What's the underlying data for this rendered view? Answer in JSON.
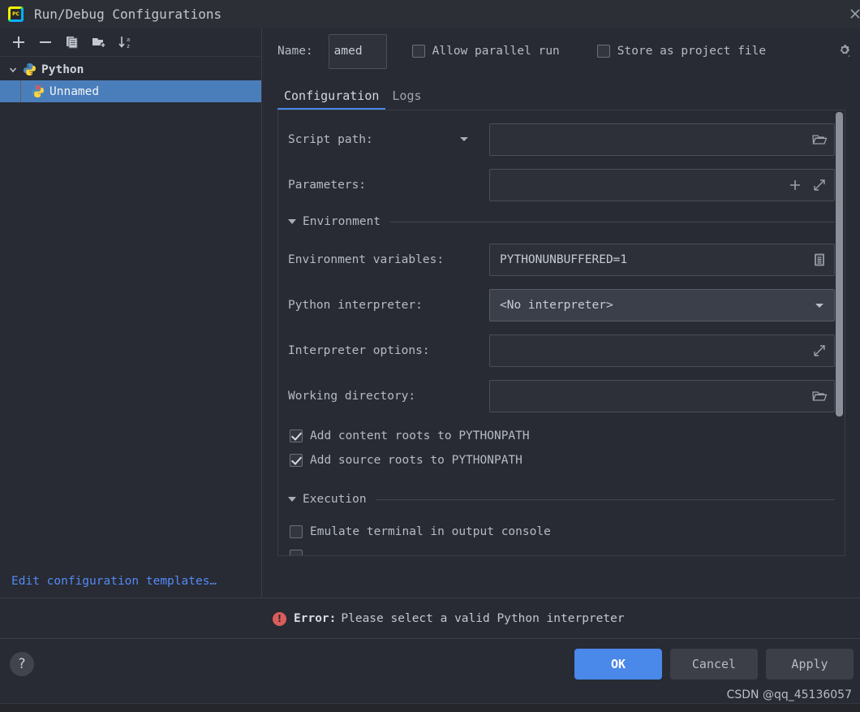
{
  "window": {
    "title": "Run/Debug Configurations",
    "app_icon": "pycharm-icon",
    "close_icon": "close-icon"
  },
  "sidebar": {
    "toolbar": [
      {
        "name": "add-configuration-button",
        "icon": "plus-icon",
        "label": "+"
      },
      {
        "name": "remove-configuration-button",
        "icon": "minus-icon",
        "label": "−"
      },
      {
        "name": "copy-configuration-button",
        "icon": "copy-icon",
        "label": "Copy"
      },
      {
        "name": "save-configuration-button",
        "icon": "folder-add-icon",
        "label": "Save"
      },
      {
        "name": "sort-configurations-button",
        "icon": "sort-az-icon",
        "label": "Sort"
      }
    ],
    "tree": {
      "root": {
        "label": "Python",
        "icon": "python-icon",
        "expanded": true
      },
      "children": [
        {
          "label": "Unnamed",
          "icon": "python-error-icon",
          "selected": true
        }
      ]
    },
    "edit_templates_link": "Edit configuration templates…"
  },
  "header": {
    "name_label": "Name:",
    "name_value": "amed",
    "name_placeholder": "Unnamed",
    "allow_parallel_run": {
      "label": "Allow parallel run",
      "checked": false
    },
    "store_as_project_file": {
      "label": "Store as project file",
      "checked": false
    },
    "gear_icon": "gear-icon"
  },
  "tabs": [
    {
      "label": "Configuration",
      "active": true
    },
    {
      "label": "Logs",
      "active": false
    }
  ],
  "form": {
    "script_path": {
      "label": "Script path:",
      "value": "",
      "dropdown_icon": "chevron-down-icon",
      "browse_icon": "folder-icon"
    },
    "parameters": {
      "label": "Parameters:",
      "value": "",
      "insert_icon": "plus-icon",
      "expand_icon": "expand-icon"
    },
    "environment_section": {
      "title": "Environment",
      "expanded": true,
      "collapse_icon": "triangle-down-icon"
    },
    "environment_variables": {
      "label": "Environment variables:",
      "value": "PYTHONUNBUFFERED=1",
      "browse_icon": "list-edit-icon"
    },
    "python_interpreter": {
      "label": "Python interpreter:",
      "value": "<No interpreter>",
      "dropdown_icon": "chevron-down-icon"
    },
    "interpreter_options": {
      "label": "Interpreter options:",
      "value": "",
      "expand_icon": "expand-icon"
    },
    "working_directory": {
      "label": "Working directory:",
      "value": "",
      "browse_icon": "folder-icon"
    },
    "add_content_roots": {
      "label": "Add content roots to PYTHONPATH",
      "checked": true
    },
    "add_source_roots": {
      "label": "Add source roots to PYTHONPATH",
      "checked": true
    },
    "execution_section": {
      "title": "Execution",
      "expanded": true,
      "collapse_icon": "triangle-down-icon"
    },
    "emulate_terminal": {
      "label": "Emulate terminal in output console",
      "checked": false
    }
  },
  "error": {
    "icon": "error-icon",
    "label": "Error:",
    "message": "Please select a valid Python interpreter"
  },
  "footer": {
    "help_label": "?",
    "ok_label": "OK",
    "cancel_label": "Cancel",
    "apply_label": "Apply"
  },
  "watermark": "CSDN @qq_45136057",
  "colors": {
    "accent": "#4a88ea",
    "selection": "#4a7ebb",
    "link": "#548af7",
    "error": "#db5c5c",
    "background": "#282b33",
    "titlebar": "#2d2f36"
  }
}
